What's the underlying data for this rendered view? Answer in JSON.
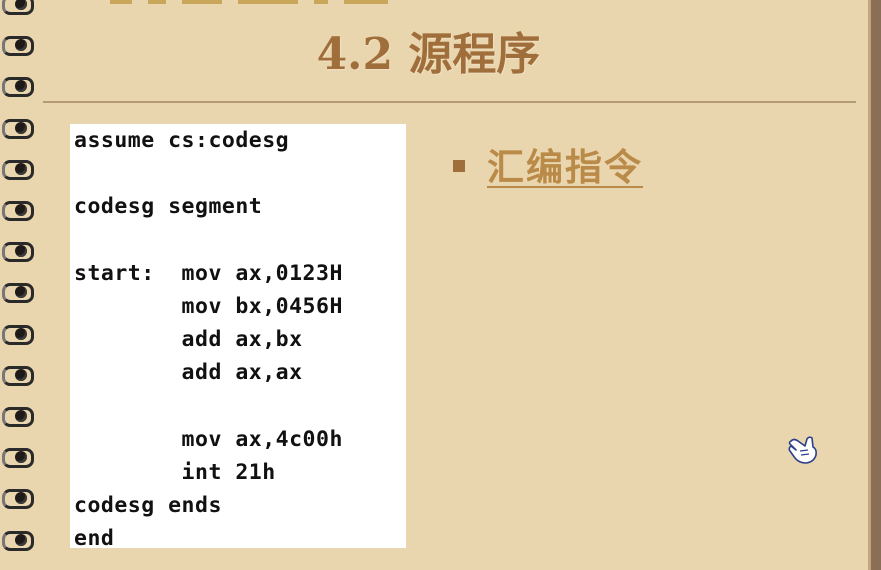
{
  "slide": {
    "title": "4.2 源程序",
    "code_lines": [
      "assume cs:codesg",
      "",
      "codesg segment",
      "",
      "start:  mov ax,0123H",
      "        mov bx,0456H",
      "        add ax,bx",
      "        add ax,ax",
      "",
      "        mov ax,4c00h",
      "        int 21h",
      "codesg ends",
      "end"
    ],
    "bullet_link": "汇编指令"
  },
  "colors": {
    "background": "#ead6ae",
    "title": "#a06e3b",
    "link": "#b98a48"
  },
  "icons": {
    "cursor": "hand-pointer-icon"
  }
}
